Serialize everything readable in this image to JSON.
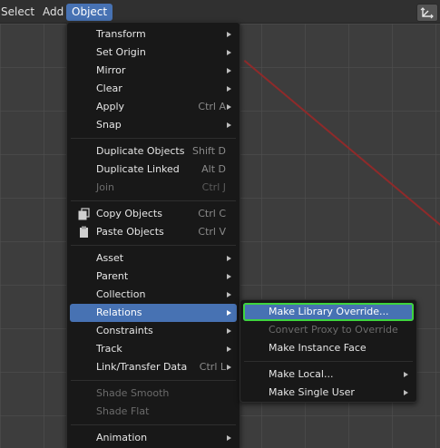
{
  "header": {
    "menus": [
      "Select",
      "Add",
      "Object"
    ],
    "gizmo_icon": "axes-gizmo-icon"
  },
  "object_menu": {
    "items": [
      {
        "label": "Transform",
        "submenu": true
      },
      {
        "label": "Set Origin",
        "submenu": true
      },
      {
        "label": "Mirror",
        "submenu": true
      },
      {
        "label": "Clear",
        "submenu": true
      },
      {
        "label": "Apply",
        "shortcut": "Ctrl A",
        "submenu": true
      },
      {
        "label": "Snap",
        "submenu": true
      },
      {
        "label": "Duplicate Objects",
        "shortcut": "Shift D"
      },
      {
        "label": "Duplicate Linked",
        "shortcut": "Alt D"
      },
      {
        "label": "Join",
        "shortcut": "Ctrl J",
        "disabled": true
      },
      {
        "label": "Copy Objects",
        "shortcut": "Ctrl C",
        "icon": "copy-icon"
      },
      {
        "label": "Paste Objects",
        "shortcut": "Ctrl V",
        "icon": "paste-icon"
      },
      {
        "label": "Asset",
        "submenu": true
      },
      {
        "label": "Parent",
        "submenu": true
      },
      {
        "label": "Collection",
        "submenu": true
      },
      {
        "label": "Relations",
        "submenu": true,
        "active": true
      },
      {
        "label": "Constraints",
        "submenu": true
      },
      {
        "label": "Track",
        "submenu": true
      },
      {
        "label": "Link/Transfer Data",
        "shortcut": "Ctrl L",
        "submenu": true
      },
      {
        "label": "Shade Smooth",
        "disabled": true
      },
      {
        "label": "Shade Flat",
        "disabled": true
      },
      {
        "label": "Animation",
        "submenu": true
      }
    ]
  },
  "relations_menu": {
    "items": [
      {
        "label": "Make Library Override...",
        "focused": true
      },
      {
        "label": "Convert Proxy to Override",
        "disabled": true
      },
      {
        "label": "Make Instance Face"
      },
      {
        "label": "Make Local...",
        "submenu": true
      },
      {
        "label": "Make Single User",
        "submenu": true
      }
    ]
  },
  "colors": {
    "accent": "#4772b3",
    "focus_outline": "#3ed43e",
    "menu_bg": "#181818",
    "viewport_bg": "#3d3d3d"
  }
}
